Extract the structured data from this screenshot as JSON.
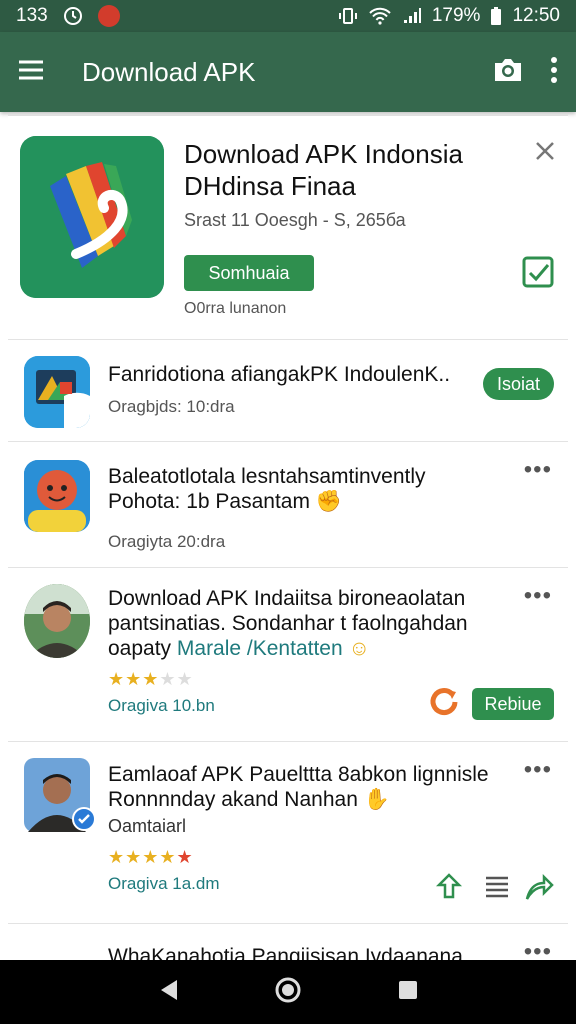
{
  "status_bar": {
    "time_left": "133",
    "battery": "179%",
    "clock": "12:50"
  },
  "app_bar": {
    "title": "Download APK",
    "icons": [
      "menu-icon",
      "camera-icon",
      "more-vertical-icon"
    ]
  },
  "featured": {
    "title_line1": "Download APK Indonsia",
    "title_line2": "DHdinsa Finaa",
    "subtitle": "Srast 11 Ooesgh - S, 265ба",
    "button_label": "Somhuaia",
    "meta": "O0rra lunanon"
  },
  "items": [
    {
      "title": "Fanridotiona afiangakPK IndoulenK..",
      "meta": "Oragbjds: 10:dra",
      "action_label": "Isoiat"
    },
    {
      "title_line1": "Baleatotlotala lesntahsamtinvently",
      "title_line2": "Pohota: 1b Pasantam",
      "meta": "Oragiyta 20:dra"
    },
    {
      "title_line1": "Download APK Indaiitsa bironeaolatan",
      "title_line2": "pantsinatias. Sondanhar t faolngahdan",
      "title_line3_dark": "oapaty ",
      "title_line3_teal": "Marale /Kentatten",
      "rating": 2.5,
      "meta": "Oragiva 10.bn",
      "action_label": "Rebiue"
    },
    {
      "title_line1": "Eamlaoaf APK Pauelttta 8abkon lignnisle",
      "title_line2": "Ronnnnday akand Nanhan",
      "subline": "Oamtaiarl",
      "rating": 4.5,
      "meta": "Oragiva 1a.dm"
    },
    {
      "title": "WhaKanahotia Pangiisisan Iydaanana"
    }
  ],
  "colors": {
    "status_bar": "#2e5a43",
    "app_bar": "#35684d",
    "accent_green": "#2f8f4e",
    "teal_text": "#1f7a7d",
    "star": "#e8b020"
  }
}
